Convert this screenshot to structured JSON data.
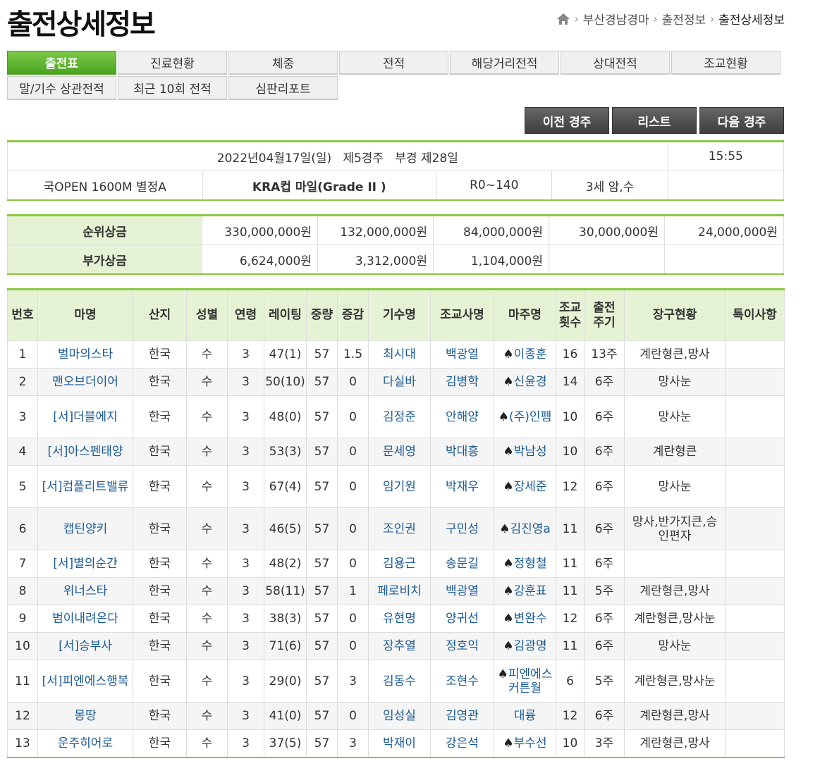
{
  "page_title": "출전상세정보",
  "breadcrumb": [
    "부산경남경마",
    "출전정보",
    "출전상세정보"
  ],
  "tabs_row1": [
    "출전표",
    "진료현황",
    "체중",
    "전적",
    "해당거리전적",
    "상대전적",
    "조교현황"
  ],
  "tabs_row2": [
    "말/기수 상관전적",
    "최근 10회 전적",
    "심판리포트"
  ],
  "nav": {
    "prev": "이전 경주",
    "list": "리스트",
    "next": "다음 경주"
  },
  "race": {
    "date_line": "2022년04월17일(일)   제5경주   부경 제28일",
    "time": "15:55",
    "grade": "국OPEN 1600M  별정A",
    "name": "KRA컵 마일(Grade II )",
    "rating": "R0~140",
    "age_sex": "3세 암,수",
    "extra": ""
  },
  "prize": {
    "rank_label": "순위상금",
    "rank": [
      "330,000,000원",
      "132,000,000원",
      "84,000,000원",
      "30,000,000원",
      "24,000,000원"
    ],
    "bonus_label": "부가상금",
    "bonus": [
      "6,624,000원",
      "3,312,000원",
      "1,104,000원",
      "",
      ""
    ]
  },
  "columns": [
    "번호",
    "마명",
    "산지",
    "성별",
    "연령",
    "레이팅",
    "중량",
    "증감",
    "기수명",
    "조교사명",
    "마주명",
    "조교\n횟수",
    "출전\n주기",
    "장구현황",
    "특이사항"
  ],
  "spade_icon": "♠",
  "rows": [
    {
      "no": "1",
      "horse": "벌마의스타",
      "origin": "한국",
      "sex": "수",
      "age": "3",
      "rating": "47(1)",
      "weight": "57",
      "change": "1.5",
      "jockey": "최시대",
      "trainer": "백광열",
      "owner": "이종훈",
      "spade": true,
      "train": "16",
      "cycle": "13주",
      "gear": "계란형큰,망사",
      "note": ""
    },
    {
      "no": "2",
      "horse": "맨오브더이어",
      "origin": "한국",
      "sex": "수",
      "age": "3",
      "rating": "50(10)",
      "weight": "57",
      "change": "0",
      "jockey": "다실바",
      "trainer": "김병학",
      "owner": "신윤경",
      "spade": true,
      "train": "14",
      "cycle": "6주",
      "gear": "망사눈",
      "note": ""
    },
    {
      "no": "3",
      "horse": "[서]더블에지",
      "origin": "한국",
      "sex": "수",
      "age": "3",
      "rating": "48(0)",
      "weight": "57",
      "change": "0",
      "jockey": "김정준",
      "trainer": "안해양",
      "owner": "(주)인펨",
      "spade": true,
      "train": "10",
      "cycle": "6주",
      "gear": "망사눈",
      "note": ""
    },
    {
      "no": "4",
      "horse": "[서]아스펜태양",
      "origin": "한국",
      "sex": "수",
      "age": "3",
      "rating": "53(3)",
      "weight": "57",
      "change": "0",
      "jockey": "문세영",
      "trainer": "박대흥",
      "owner": "박남성",
      "spade": true,
      "train": "10",
      "cycle": "6주",
      "gear": "계란형큰",
      "note": ""
    },
    {
      "no": "5",
      "horse": "[서]컴플리트밸류",
      "origin": "한국",
      "sex": "수",
      "age": "3",
      "rating": "67(4)",
      "weight": "57",
      "change": "0",
      "jockey": "임기원",
      "trainer": "박재우",
      "owner": "장세준",
      "spade": true,
      "train": "12",
      "cycle": "6주",
      "gear": "망사눈",
      "note": ""
    },
    {
      "no": "6",
      "horse": "캡틴양키",
      "origin": "한국",
      "sex": "수",
      "age": "3",
      "rating": "46(5)",
      "weight": "57",
      "change": "0",
      "jockey": "조인권",
      "trainer": "구민성",
      "owner": "김진영a",
      "spade": true,
      "train": "11",
      "cycle": "6주",
      "gear": "망사,반가지큰,승인편자",
      "note": ""
    },
    {
      "no": "7",
      "horse": "[서]별의순간",
      "origin": "한국",
      "sex": "수",
      "age": "3",
      "rating": "48(2)",
      "weight": "57",
      "change": "0",
      "jockey": "김용근",
      "trainer": "송문길",
      "owner": "정형철",
      "spade": true,
      "train": "11",
      "cycle": "6주",
      "gear": "",
      "note": ""
    },
    {
      "no": "8",
      "horse": "위너스타",
      "origin": "한국",
      "sex": "수",
      "age": "3",
      "rating": "58(11)",
      "weight": "57",
      "change": "1",
      "jockey": "페로비치",
      "trainer": "백광열",
      "owner": "강훈표",
      "spade": true,
      "train": "11",
      "cycle": "5주",
      "gear": "계란형큰,망사",
      "note": ""
    },
    {
      "no": "9",
      "horse": "범이내려온다",
      "origin": "한국",
      "sex": "수",
      "age": "3",
      "rating": "38(3)",
      "weight": "57",
      "change": "0",
      "jockey": "유현명",
      "trainer": "양귀선",
      "owner": "변완수",
      "spade": true,
      "train": "12",
      "cycle": "6주",
      "gear": "계란형큰,망사눈",
      "note": ""
    },
    {
      "no": "10",
      "horse": "[서]승부사",
      "origin": "한국",
      "sex": "수",
      "age": "3",
      "rating": "71(6)",
      "weight": "57",
      "change": "0",
      "jockey": "장추열",
      "trainer": "정호익",
      "owner": "김광명",
      "spade": true,
      "train": "11",
      "cycle": "6주",
      "gear": "망사눈",
      "note": ""
    },
    {
      "no": "11",
      "horse": "[서]피엔에스행복",
      "origin": "한국",
      "sex": "수",
      "age": "3",
      "rating": "29(0)",
      "weight": "57",
      "change": "3",
      "jockey": "김동수",
      "trainer": "조현수",
      "owner": "피엔에스커튼월",
      "spade": true,
      "train": "6",
      "cycle": "5주",
      "gear": "계란형큰,망사눈",
      "note": ""
    },
    {
      "no": "12",
      "horse": "몽땅",
      "origin": "한국",
      "sex": "수",
      "age": "3",
      "rating": "41(0)",
      "weight": "57",
      "change": "0",
      "jockey": "임성실",
      "trainer": "김영관",
      "owner": "대륭",
      "spade": false,
      "train": "12",
      "cycle": "6주",
      "gear": "계란형큰,망사",
      "note": ""
    },
    {
      "no": "13",
      "horse": "운주히어로",
      "origin": "한국",
      "sex": "수",
      "age": "3",
      "rating": "37(5)",
      "weight": "57",
      "change": "3",
      "jockey": "박재이",
      "trainer": "강은석",
      "owner": "부수선",
      "spade": true,
      "train": "10",
      "cycle": "3주",
      "gear": "계란형큰,망사",
      "note": ""
    }
  ]
}
